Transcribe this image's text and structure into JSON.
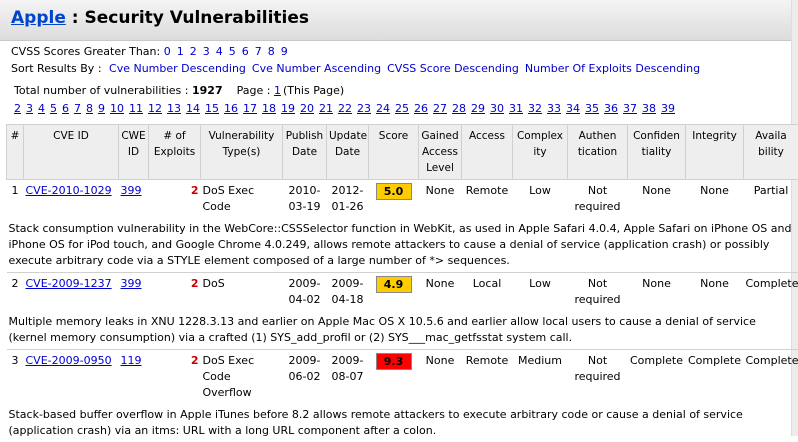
{
  "header": {
    "vendor_link": "Apple",
    "title_suffix": " : Security Vulnerabilities"
  },
  "cvss_filter": {
    "label": "CVSS Scores Greater Than:",
    "options": [
      "0",
      "1",
      "2",
      "3",
      "4",
      "5",
      "6",
      "7",
      "8",
      "9"
    ]
  },
  "sort": {
    "label": "Sort Results By :",
    "options": [
      "Cve Number Descending",
      "Cve Number Ascending",
      "CVSS Score Descending",
      "Number Of Exploits Descending"
    ]
  },
  "pagination": {
    "total_label": "Total number of vulnerabilities :",
    "total": "1927",
    "page_label": "Page :",
    "current_page": "1",
    "current_note": "(This Page)",
    "pages": [
      "2",
      "3",
      "4",
      "5",
      "6",
      "7",
      "8",
      "9",
      "10",
      "11",
      "12",
      "13",
      "14",
      "15",
      "16",
      "17",
      "18",
      "19",
      "20",
      "21",
      "22",
      "23",
      "24",
      "25",
      "26",
      "27",
      "28",
      "29",
      "30",
      "31",
      "32",
      "33",
      "34",
      "35",
      "36",
      "37",
      "38",
      "39"
    ]
  },
  "columns": {
    "num": "#",
    "cve": "CVE ID",
    "cwe": "CWE ID",
    "exploits": "# of Exploits",
    "vtype": "Vulnerability Type(s)",
    "publish": "Publish Date",
    "update": "Update Date",
    "score": "Score",
    "gained": "Gained Access Level",
    "access": "Access",
    "complexity": "Complex ity",
    "auth": "Authen tication",
    "conf": "Confiden tiality",
    "integ": "Integrity",
    "avail": "Availa bility"
  },
  "rows": [
    {
      "num": "1",
      "cve": "CVE-2010-1029",
      "cwe": "399",
      "exploits": "2",
      "vtype": "DoS Exec Code",
      "publish": "2010-03-19",
      "update": "2012-01-26",
      "score": "5.0",
      "score_color": "#ffcc00",
      "gained": "None",
      "access": "Remote",
      "complexity": "Low",
      "auth": "Not required",
      "conf": "None",
      "integ": "None",
      "avail": "Partial",
      "summary": "Stack consumption vulnerability in the WebCore::CSSSelector function in WebKit, as used in Apple Safari 4.0.4, Apple Safari on iPhone OS and iPhone OS for iPod touch, and Google Chrome 4.0.249, allows remote attackers to cause a denial of service (application crash) or possibly execute arbitrary code via a STYLE element composed of a large number of *> sequences."
    },
    {
      "num": "2",
      "cve": "CVE-2009-1237",
      "cwe": "399",
      "exploits": "2",
      "vtype": "DoS",
      "publish": "2009-04-02",
      "update": "2009-04-18",
      "score": "4.9",
      "score_color": "#ffcc00",
      "gained": "None",
      "access": "Local",
      "complexity": "Low",
      "auth": "Not required",
      "conf": "None",
      "integ": "None",
      "avail": "Complete",
      "summary": "Multiple memory leaks in XNU 1228.3.13 and earlier on Apple Mac OS X 10.5.6 and earlier allow local users to cause a denial of service (kernel memory consumption) via a crafted (1) SYS_add_profil or (2) SYS___mac_getfsstat system call."
    },
    {
      "num": "3",
      "cve": "CVE-2009-0950",
      "cwe": "119",
      "exploits": "2",
      "vtype": "DoS Exec Code Overflow",
      "publish": "2009-06-02",
      "update": "2009-08-07",
      "score": "9.3",
      "score_color": "#ff0000",
      "gained": "None",
      "access": "Remote",
      "complexity": "Medium",
      "auth": "Not required",
      "conf": "Complete",
      "integ": "Complete",
      "avail": "Complete",
      "summary": "Stack-based buffer overflow in Apple iTunes before 8.2 allows remote attackers to execute arbitrary code or cause a denial of service (application crash) via an itms: URL with a long URL component after a colon."
    }
  ]
}
